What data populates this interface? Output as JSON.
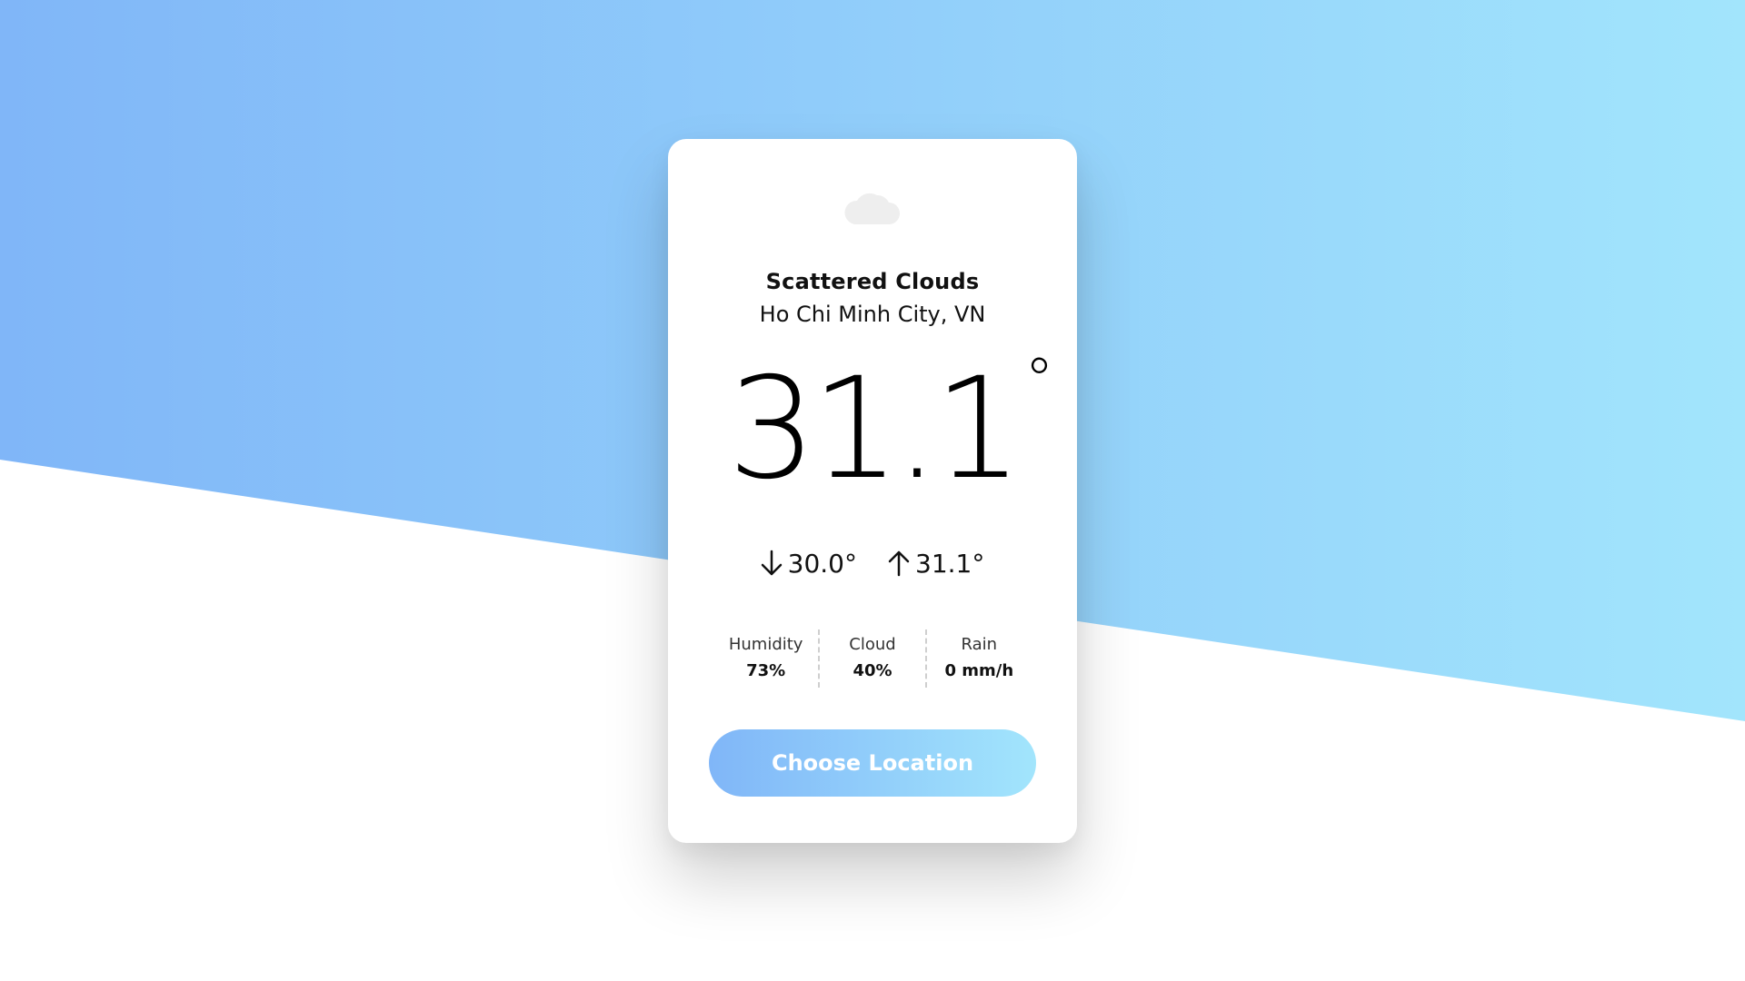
{
  "weather": {
    "icon": "cloud-icon",
    "description": "Scattered Clouds",
    "location": "Ho Chi Minh City, VN",
    "temperature": "31.1",
    "degree_symbol": "°",
    "min_temp": "30.0°",
    "max_temp": "31.1°"
  },
  "stats": {
    "humidity_label": "Humidity",
    "humidity_value": "73%",
    "cloud_label": "Cloud",
    "cloud_value": "40%",
    "rain_label": "Rain",
    "rain_value": "0 mm/h"
  },
  "actions": {
    "choose_location_label": "Choose Location"
  },
  "colors": {
    "gradient_start": "#80b6f8",
    "gradient_end": "#a2e5fc",
    "card_background": "#ffffff",
    "text": "#111111",
    "icon": "#eeeeee"
  }
}
